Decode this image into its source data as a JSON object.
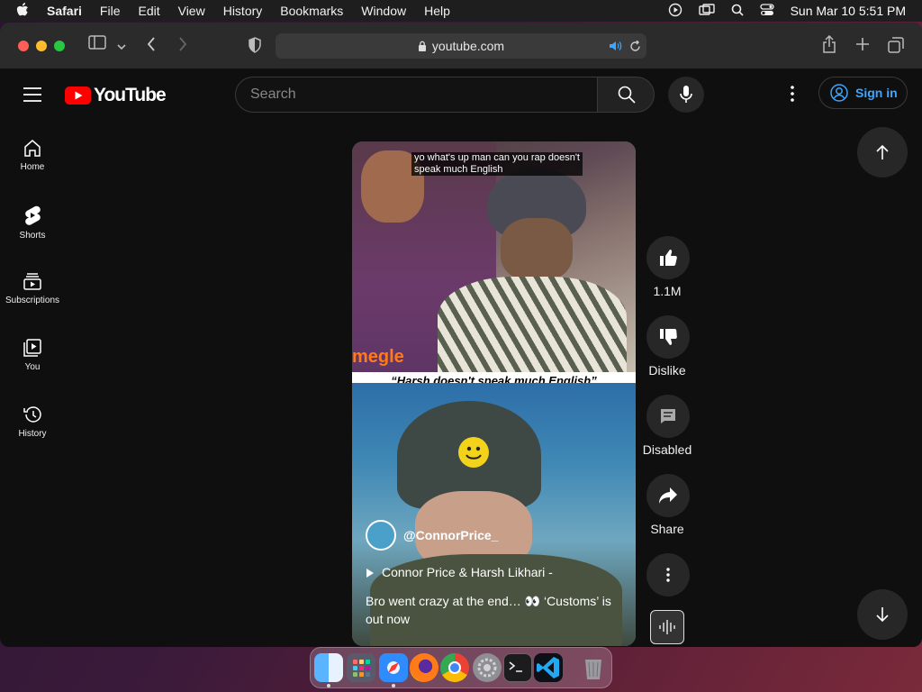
{
  "menubar": {
    "app": "Safari",
    "items": [
      "File",
      "Edit",
      "View",
      "History",
      "Bookmarks",
      "Window",
      "Help"
    ],
    "datetime": "Sun Mar 10  5:51 PM"
  },
  "browser": {
    "url": "youtube.com"
  },
  "header": {
    "logo_text": "YouTube",
    "search_placeholder": "Search",
    "signin_label": "Sign in"
  },
  "sidebar": {
    "items": [
      {
        "label": "Home",
        "icon": "home-icon"
      },
      {
        "label": "Shorts",
        "icon": "shorts-icon"
      },
      {
        "label": "Subscriptions",
        "icon": "subscriptions-icon"
      },
      {
        "label": "You",
        "icon": "you-icon"
      },
      {
        "label": "History",
        "icon": "history-icon"
      }
    ]
  },
  "video": {
    "caption": "yo what's up man can you rap doesn't speak much English",
    "brand": "megle",
    "banner": "“Harsh doesn't speak much English”",
    "channel": "@ConnorPrice_",
    "song": "Connor Price & Harsh Likhari -",
    "description": "Bro went crazy at the end… 👀 ‘Customs’ is out now"
  },
  "actions": {
    "like_count": "1.1M",
    "dislike_label": "Dislike",
    "comments_label": "Disabled",
    "share_label": "Share"
  },
  "colors": {
    "yt_red": "#ff0000",
    "link_blue": "#3ea6ff",
    "bg": "#0f0f0f"
  }
}
